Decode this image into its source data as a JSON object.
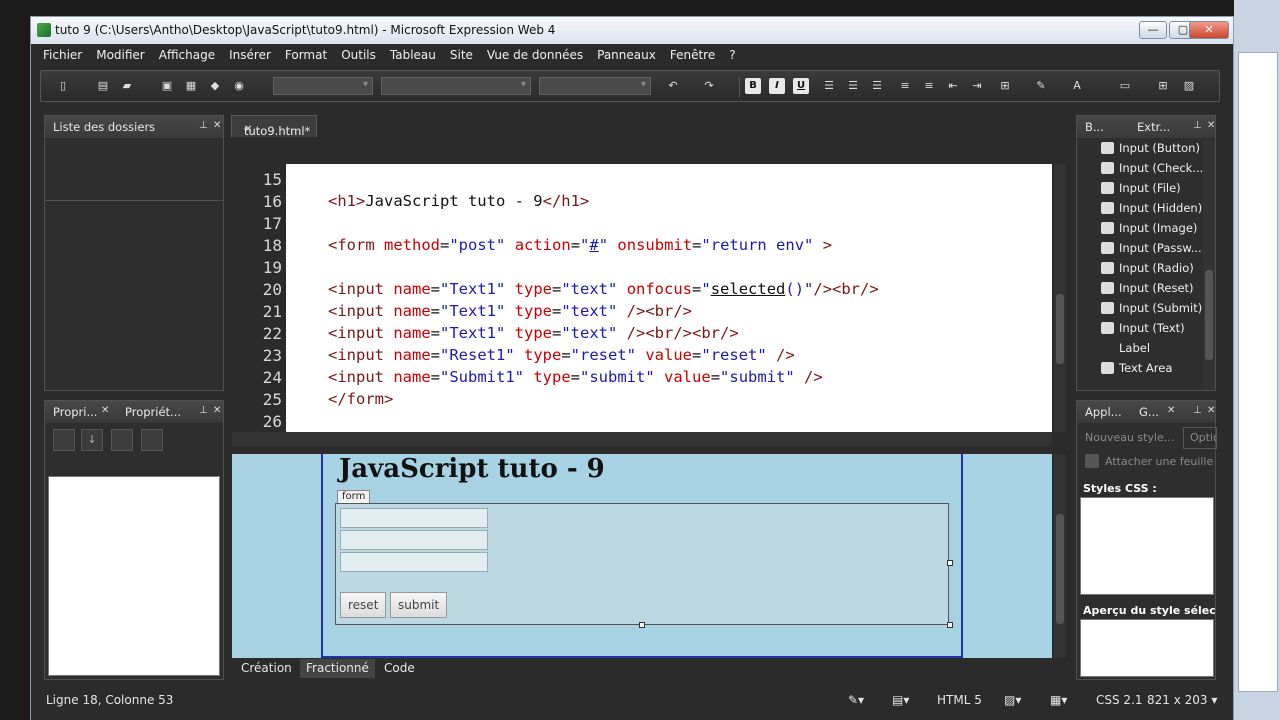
{
  "window": {
    "title": "tuto 9 (C:\\Users\\Antho\\Desktop\\JavaScript\\tuto9.html) - Microsoft Expression Web 4",
    "buttons": {
      "minimize": "—",
      "maximize": "▢",
      "close": "✕"
    }
  },
  "menu": [
    "Fichier",
    "Modifier",
    "Affichage",
    "Insérer",
    "Format",
    "Outils",
    "Tableau",
    "Site",
    "Vue de données",
    "Panneaux",
    "Fenêtre",
    "?"
  ],
  "toolbar": {
    "bold": "B",
    "italic": "I",
    "underline": "U"
  },
  "panels": {
    "folder_list": {
      "title": "Liste des dossiers"
    },
    "properties": {
      "tab1": "Propri...",
      "tab2": "Propriét..."
    },
    "toolbox": {
      "tab1": "B...",
      "tab2": "Extr...",
      "items": [
        "Input (Button)",
        "Input (Check...",
        "Input (File)",
        "Input (Hidden)",
        "Input (Image)",
        "Input (Passw...",
        "Input (Radio)",
        "Input (Reset)",
        "Input (Submit)",
        "Input (Text)",
        "Label",
        "Text Area"
      ]
    },
    "styles": {
      "tab1": "Appl...",
      "tab2": "G...",
      "new_style": "Nouveau style...",
      "options": "Optio",
      "attach": "Attacher une feuille de",
      "css_styles_label": "Styles CSS :",
      "preview_label": "Aperçu du style sélec..."
    }
  },
  "document": {
    "tab_label": "tuto9.html*",
    "line_numbers": [
      "15",
      "16",
      "17",
      "18",
      "19",
      "20",
      "21",
      "22",
      "23",
      "24",
      "25",
      "26"
    ]
  },
  "code": {
    "l16": {
      "t1": "<h1>",
      "text": "JavaScript tuto - 9",
      "t2": "</h1>"
    },
    "l18": {
      "t1": "<form ",
      "a1": "method",
      "eq1": "=",
      "v1": "\"post\"",
      "a2": "action",
      "eq2": "=",
      "v2a": "\"",
      "v2b": "#",
      "v2c": "\"",
      "a3": "onsubmit",
      "eq3": "=",
      "v3": "\"return env\"",
      "t2": " >"
    },
    "l20": {
      "t1": "<input ",
      "a1": "name",
      "v1": "\"Text1\"",
      "a2": "type",
      "v2": "\"text\"",
      "a3": "onfocus",
      "v3a": "\"",
      "v3b": "selected",
      "v3c": "()\"",
      "t2": "/><br/>"
    },
    "l21": {
      "t1": "<input ",
      "a1": "name",
      "v1": "\"Text1\"",
      "a2": "type",
      "v2": "\"text\"",
      "t2": " /><br/>"
    },
    "l22": {
      "t1": "<input ",
      "a1": "name",
      "v1": "\"Text1\"",
      "a2": "type",
      "v2": "\"text\"",
      "t2": " /><br/><br/>"
    },
    "l23": {
      "t1": "<input ",
      "a1": "name",
      "v1": "\"Reset1\"",
      "a2": "type",
      "v2": "\"reset\"",
      "a3": "value",
      "v3": "\"reset\"",
      "t2": " />"
    },
    "l24": {
      "t1": "<input ",
      "a1": "name",
      "v1": "\"Submit1\"",
      "a2": "type",
      "v2": "\"submit\"",
      "a3": "value",
      "v3": "\"submit\"",
      "t2": " />"
    },
    "l25": {
      "t1": "</form>"
    }
  },
  "design": {
    "heading": "JavaScript tuto - 9",
    "form_label": "form",
    "reset_label": "reset",
    "submit_label": "submit"
  },
  "view_tabs": {
    "design": "Création",
    "split": "Fractionné",
    "code": "Code"
  },
  "status": {
    "position": "Ligne 18, Colonne 53",
    "doctype": "HTML 5",
    "css": "CSS 2.1",
    "size": "821 x 203"
  }
}
